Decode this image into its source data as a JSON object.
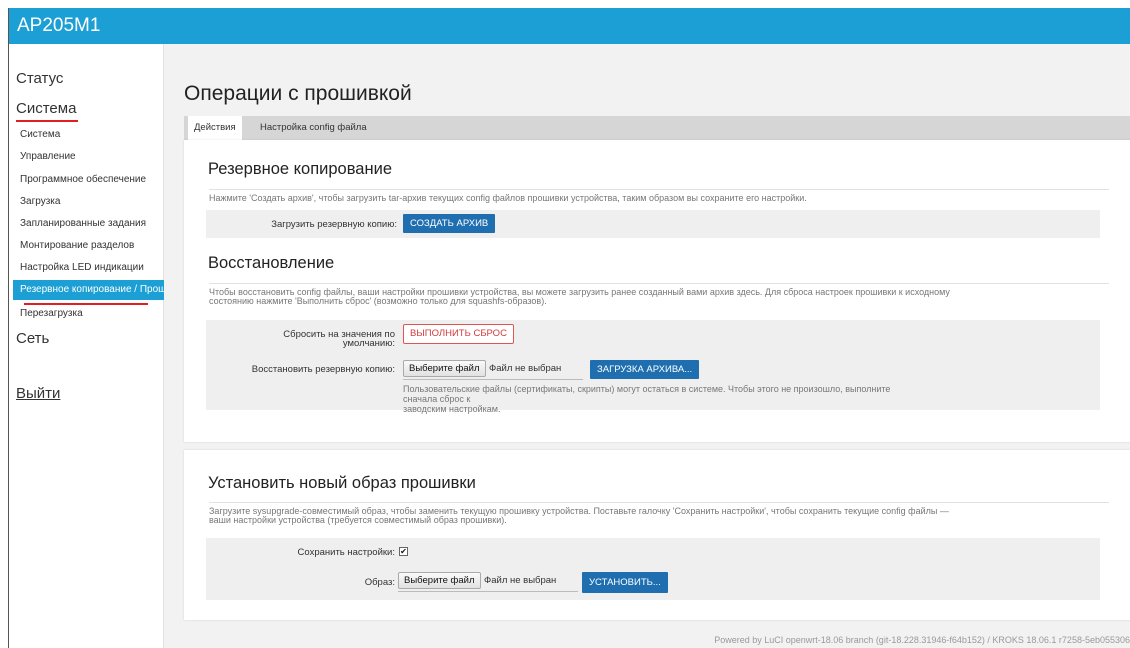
{
  "app": {
    "title": "AP205M1"
  },
  "sidebar": {
    "top_items": [
      "Статус",
      "Система",
      "Сеть"
    ],
    "sub_items": [
      "Система",
      "Управление",
      "Программное обеспечение",
      "Загрузка",
      "Запланированные задания",
      "Монтирование разделов",
      "Настройка LED индикации",
      "Резервное копирование / Прошивка",
      "Перезагрузка"
    ],
    "logout": "Выйти"
  },
  "page": {
    "title": "Операции с прошивкой",
    "tabs": [
      "Действия",
      "Настройка config файла"
    ]
  },
  "backup": {
    "title": "Резервное копирование",
    "desc": "Нажмите 'Создать архив', чтобы загрузить tar-архив текущих config файлов прошивки устройства, таким образом вы сохраните его настройки.",
    "label": "Загрузить резервную копию:",
    "button": "СОЗДАТЬ АРХИВ"
  },
  "restore": {
    "title": "Восстановление",
    "desc_line1": "Чтобы восстановить config файлы, ваши настройки прошивки устройства, вы можете загрузить ранее созданный вами архив здесь. Для сброса настроек прошивки к исходному",
    "desc_line2": "состоянию нажмите 'Выполнить сброс' (возможно только для squashfs-образов).",
    "reset_label_line1": "Сбросить на значения по",
    "reset_label_line2": "умолчанию:",
    "reset_button": "ВЫПОЛНИТЬ СБРОС",
    "restore_label": "Восстановить резервную копию:",
    "file_button": "Выберите файл",
    "file_none": "Файл не выбран",
    "upload_button": "ЗАГРУЗКА АРХИВА...",
    "note_line1": "Пользовательские файлы (сертификаты, скрипты) могут остаться в системе. Чтобы этого не произошло, выполните сначала сброс к",
    "note_line2": "заводским настройкам."
  },
  "flash": {
    "title": "Установить новый образ прошивки",
    "desc_line1": "Загрузите sysupgrade-совместимый образ, чтобы заменить текущую прошивку устройства. Поставьте галочку 'Сохранить настройки', чтобы сохранить текущие config файлы —",
    "desc_line2": "ваши настройки устройства (требуется совместимый образ прошивки).",
    "keep_label": "Сохранить настройки:",
    "keep_checked": "✔",
    "image_label": "Образ:",
    "file_button": "Выберите файл",
    "file_none": "Файл не выбран",
    "install_button": "УСТАНОВИТЬ..."
  },
  "footer": "Powered by LuCI openwrt-18.06 branch (git-18.228.31946-f64b152) / KROKS 18.06.1 r7258-5eb055306",
  "colors": {
    "accent": "#1b9fd4",
    "button": "#1f6fb0",
    "danger": "#e05555",
    "underline": "#e02020"
  }
}
